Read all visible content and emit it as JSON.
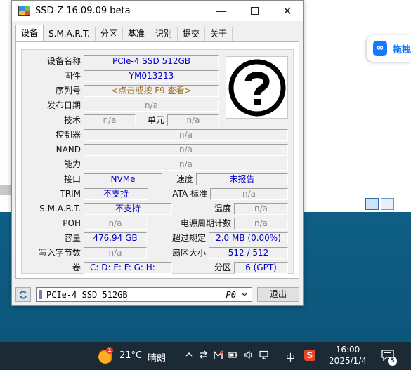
{
  "window": {
    "title": "SSD-Z 16.09.09 beta",
    "min_glyph": "—",
    "close_glyph": "✕"
  },
  "tabs": [
    {
      "label": "设备",
      "active": true
    },
    {
      "label": "S.M.A.R.T."
    },
    {
      "label": "分区"
    },
    {
      "label": "基准"
    },
    {
      "label": "识别"
    },
    {
      "label": "提交"
    },
    {
      "label": "关于"
    }
  ],
  "device": {
    "name_label": "设备名称",
    "name_value": "PCIe-4 SSD 512GB",
    "firmware_label": "固件",
    "firmware_value": "YM013213",
    "serial_label": "序列号",
    "serial_value": "<点击或按 F9 查看>",
    "release_label": "发布日期",
    "release_value": "n/a",
    "tech_label": "技术",
    "tech_value": "n/a",
    "cell_label": "单元",
    "cell_value": "n/a",
    "controller_label": "控制器",
    "controller_value": "n/a",
    "nand_label": "NAND",
    "nand_value": "n/a",
    "capability_label": "能力",
    "capability_value": "n/a",
    "interface_label": "接口",
    "interface_value": "NVMe",
    "speed_label": "速度",
    "speed_value": "未报告",
    "trim_label": "TRIM",
    "trim_value": "不支持",
    "ata_label": "ATA 标准",
    "ata_value": "n/a",
    "smart_label": "S.M.A.R.T.",
    "smart_value": "不支持",
    "temp_label": "温度",
    "temp_value": "n/a",
    "poh_label": "POH",
    "poh_value": "n/a",
    "power_cycle_label": "电源周期计数",
    "power_cycle_value": "n/a",
    "capacity_label": "容量",
    "capacity_value": "476.94 GB",
    "over_label": "超过规定",
    "over_value": "2.0 MB (0.00%)",
    "bytes_written_label": "写入字节数",
    "bytes_written_value": "n/a",
    "sector_label": "扇区大小",
    "sector_value": "512 / 512",
    "volume_label": "卷",
    "volume_value": "C:  D:  E:  F:  G:  H:",
    "partition_label": "分区",
    "partition_value": "6 (GPT)"
  },
  "bottom": {
    "selected_drive": "PCIe-4 SSD 512GB",
    "drive_port": "P0",
    "exit_label": "退出"
  },
  "side_panel": {
    "label": "拖拽"
  },
  "taskbar": {
    "weather_badge": "1",
    "temperature": "21°C",
    "condition": "晴朗",
    "ime": "中",
    "s_app": "S",
    "time": "16:00",
    "date": "2025/1/4",
    "notification_count": "3"
  },
  "colors": {
    "value_blue": "#0000c8",
    "value_gray": "#8c8c8c",
    "serial_brown": "#9a6b1f",
    "taskbar_bg": "#1c2a36"
  }
}
